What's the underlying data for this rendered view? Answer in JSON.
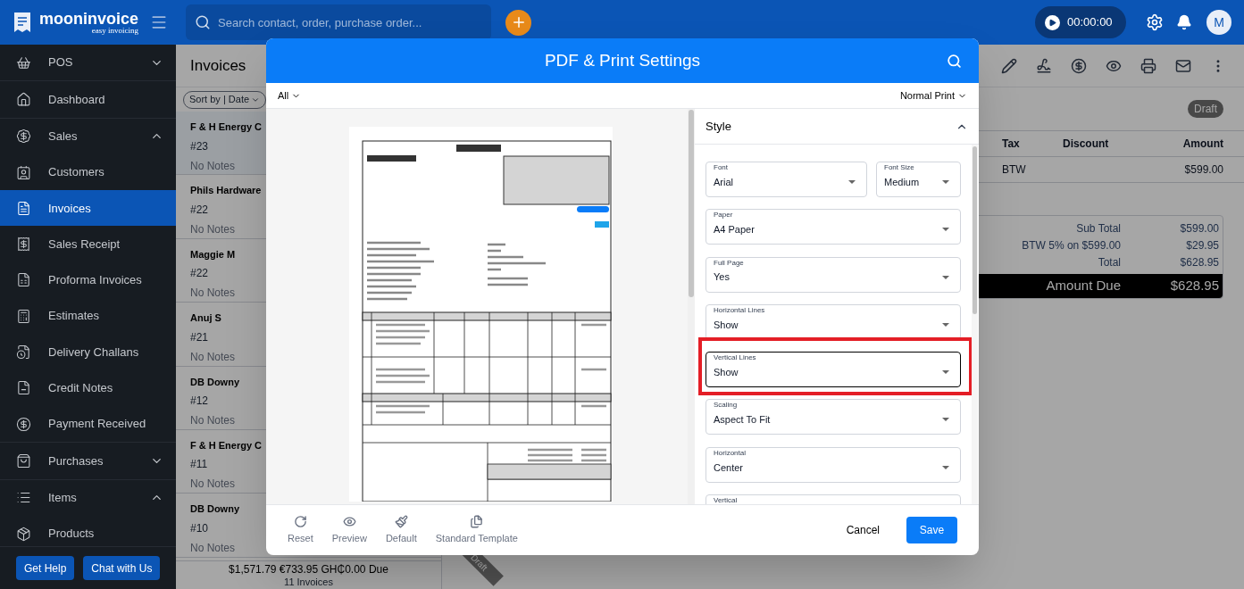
{
  "topbar": {
    "logo": {
      "name": "mooninvoice",
      "tagline": "easy invoicing"
    },
    "search": {
      "placeholder": "Search contact, order, purchase order..."
    },
    "timer": "00:00:00",
    "avatar": "M"
  },
  "sidebar": {
    "entries": [
      {
        "kind": "group",
        "label": "POS",
        "expanded": false
      },
      {
        "kind": "link",
        "label": "Dashboard",
        "selected": false
      },
      {
        "kind": "group",
        "label": "Sales",
        "expanded": true,
        "children": [
          {
            "label": "Customers",
            "selected": false
          },
          {
            "label": "Invoices",
            "selected": true
          },
          {
            "label": "Sales Receipt",
            "selected": false
          },
          {
            "label": "Proforma Invoices",
            "selected": false
          },
          {
            "label": "Estimates",
            "selected": false
          },
          {
            "label": "Delivery Challans",
            "selected": false
          },
          {
            "label": "Credit Notes",
            "selected": false
          },
          {
            "label": "Payment Received",
            "selected": false
          }
        ]
      },
      {
        "kind": "group",
        "label": "Purchases",
        "expanded": false
      },
      {
        "kind": "group",
        "label": "Items",
        "expanded": true,
        "children": [
          {
            "label": "Products",
            "selected": false
          }
        ]
      }
    ],
    "buttons": [
      "Get Help",
      "Chat with Us"
    ]
  },
  "invoice_list": {
    "title": "Invoices",
    "sort": "Sort by | Date",
    "items": [
      {
        "name": "F & H Energy C",
        "number": "#23",
        "notes": "No Notes",
        "selected": true
      },
      {
        "name": "Phils Hardware",
        "number": "#22",
        "notes": "No Notes",
        "selected": false
      },
      {
        "name": "Maggie M",
        "number": "#22",
        "notes": "No Notes",
        "selected": false
      },
      {
        "name": "Anuj S",
        "number": "#21",
        "notes": "No Notes",
        "selected": false
      },
      {
        "name": "DB Downy",
        "number": "#12",
        "notes": "No Notes",
        "selected": false
      },
      {
        "name": "F & H Energy C",
        "number": "#11",
        "notes": "No Notes",
        "selected": false
      },
      {
        "name": "DB Downy",
        "number": "#10",
        "notes": "No Notes",
        "selected": false
      }
    ],
    "footer": {
      "totals": "$1,571.79 €733.95 GH₵0.00 Due",
      "count": "11 Invoices"
    }
  },
  "detail": {
    "status": "Draft",
    "columns": [
      "Tax",
      "Discount",
      "Amount"
    ],
    "row": {
      "tax": "BTW",
      "amount": "$599.00"
    },
    "totals": [
      {
        "label": "Sub Total",
        "value": "$599.00"
      },
      {
        "label": "BTW 5% on $599.00",
        "value": "$29.95"
      },
      {
        "label": "Total",
        "value": "$628.95"
      }
    ],
    "amount_due": {
      "label": "Amount Due",
      "value": "$628.95"
    },
    "ribbon": "Draft"
  },
  "dialog": {
    "title": "PDF & Print Settings",
    "filter": "All",
    "print_mode": "Normal Print",
    "preview": {
      "kind": "picture"
    },
    "style_panel": {
      "title": "Style",
      "expanded": true,
      "rows": [
        [
          {
            "label": "Font",
            "value": "Arial",
            "focused": false,
            "highlighted": false
          },
          {
            "label": "Font Size",
            "value": "Medium",
            "focused": false,
            "highlighted": false
          }
        ],
        [
          {
            "label": "Paper",
            "value": "A4 Paper",
            "focused": false,
            "highlighted": false
          }
        ],
        [
          {
            "label": "Full Page",
            "value": "Yes",
            "focused": false,
            "highlighted": false
          }
        ],
        [
          {
            "label": "Horizontal Lines",
            "value": "Show",
            "focused": false,
            "highlighted": false
          }
        ],
        [
          {
            "label": "Vertical Lines",
            "value": "Show",
            "focused": true,
            "highlighted": true
          }
        ],
        [
          {
            "label": "Scaling",
            "value": "Aspect To Fit",
            "focused": false,
            "highlighted": false
          }
        ],
        [
          {
            "label": "Horizontal",
            "value": "Center",
            "focused": false,
            "highlighted": false
          }
        ],
        [
          {
            "label": "Vertical",
            "focused": false,
            "highlighted": false
          }
        ]
      ]
    },
    "tools": [
      "Reset",
      "Preview",
      "Default",
      "Standard Template"
    ],
    "cancel": "Cancel",
    "save": "Save"
  }
}
